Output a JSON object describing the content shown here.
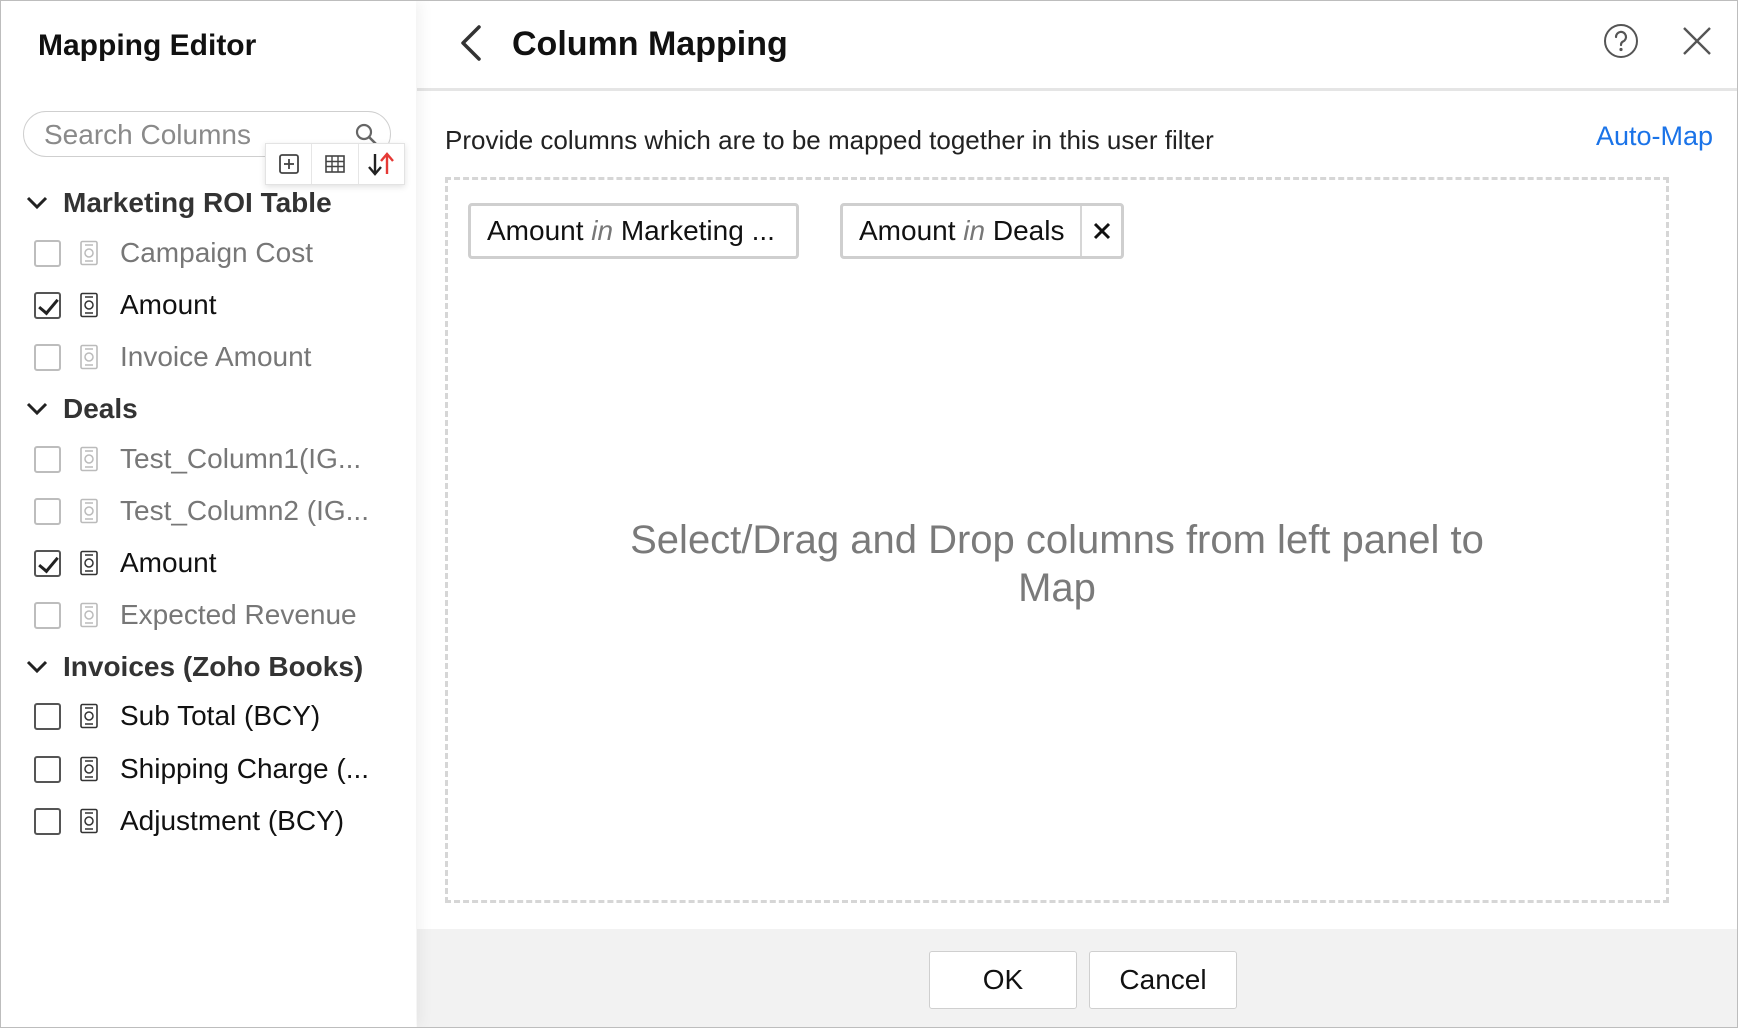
{
  "left_panel": {
    "title": "Mapping Editor",
    "search": {
      "placeholder": "Search Columns",
      "value": ""
    },
    "toolbar": [
      {
        "icon": "add-box-icon"
      },
      {
        "icon": "table-grid-icon"
      },
      {
        "icon": "sort-icon"
      }
    ],
    "groups": [
      {
        "name": "Marketing ROI Table",
        "expanded": true,
        "columns": [
          {
            "label": "Campaign Cost",
            "checked": false,
            "enabled": false
          },
          {
            "label": "Amount",
            "checked": true,
            "enabled": true
          },
          {
            "label": "Invoice Amount",
            "checked": false,
            "enabled": false
          }
        ]
      },
      {
        "name": "Deals",
        "expanded": true,
        "columns": [
          {
            "label": "Test_Column1(IG...",
            "checked": false,
            "enabled": false
          },
          {
            "label": "Test_Column2 (IG...",
            "checked": false,
            "enabled": false
          },
          {
            "label": "Amount",
            "checked": true,
            "enabled": true
          },
          {
            "label": "Expected Revenue",
            "checked": false,
            "enabled": false
          }
        ]
      },
      {
        "name": "Invoices (Zoho Books)",
        "expanded": true,
        "columns": [
          {
            "label": "Sub Total (BCY)",
            "checked": false,
            "enabled": true
          },
          {
            "label": "Shipping Charge (...",
            "checked": false,
            "enabled": true
          },
          {
            "label": "Adjustment (BCY)",
            "checked": false,
            "enabled": true
          }
        ]
      }
    ]
  },
  "right_panel": {
    "title": "Column Mapping",
    "description": "Provide columns which are to be mapped together in this user filter",
    "auto_map_label": "Auto-Map",
    "chips": [
      {
        "column": "Amount",
        "in_label": "in",
        "table": "Marketing ...",
        "removable": false
      },
      {
        "column": "Amount",
        "in_label": "in",
        "table": "Deals",
        "removable": true
      }
    ],
    "hint_line1": "Select/Drag and Drop columns from left panel to",
    "hint_line2": "Map",
    "ok_label": "OK",
    "cancel_label": "Cancel"
  },
  "colors": {
    "accent": "#1a73e8",
    "footer_bg": "#f2f2f2",
    "hint_text": "#7a7a7a"
  }
}
